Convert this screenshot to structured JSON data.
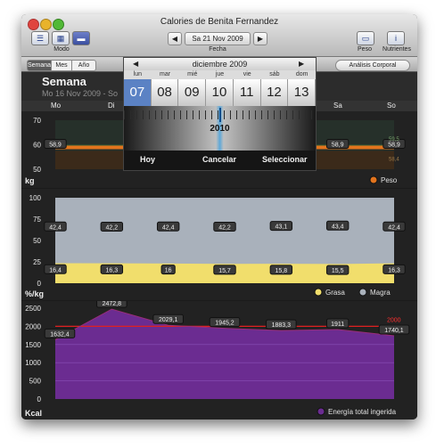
{
  "window": {
    "title": "Calories de Benita Fernandez"
  },
  "toolbar": {
    "date_prev": "◀",
    "date_value": "Sa 21 Nov 2009",
    "date_next": "▶",
    "modo_label": "Modo",
    "fecha_label": "Fecha",
    "peso_label": "Peso",
    "nutrientes_label": "Nutrientes"
  },
  "subbar": {
    "tabs": [
      "Semana",
      "Mes",
      "Año"
    ],
    "analysis_button": "Análisis Corporal"
  },
  "header": {
    "title": "Semana",
    "subtitle": "Mo 16 Nov 2009 - So"
  },
  "days": {
    "mo": "Mo",
    "di": "Di",
    "sa": "Sa",
    "so": "So"
  },
  "calendar": {
    "month": "diciembre 2009",
    "prev": "◀",
    "next": "▶",
    "weekdays": [
      "lun",
      "mar",
      "mié",
      "jue",
      "vie",
      "sáb",
      "dom"
    ],
    "dates": [
      "07",
      "08",
      "09",
      "10",
      "11",
      "12",
      "13"
    ],
    "selected_index": 0,
    "year": "2010",
    "hoy": "Hoy",
    "cancelar": "Cancelar",
    "seleccionar": "Seleccionar"
  },
  "colors": {
    "weight_line": "#e2741d",
    "fat_area": "#f1de6c",
    "lean_area": "#a9b1bb",
    "energy_area": "#6b2c91",
    "target_line": "#e02020",
    "selected_date": "#5b82c4"
  },
  "chart_data": [
    {
      "type": "line",
      "ylabel": "kg",
      "ylim": [
        50,
        70
      ],
      "yticks": [
        "70",
        "60",
        "50"
      ],
      "values": [
        58.9,
        58.9,
        58.9,
        58.9,
        58.9,
        58.9,
        58.9
      ],
      "value_labels": [
        "58,9",
        "58,9",
        "58,9"
      ],
      "extra_labels": [
        "59,5",
        "58,4"
      ],
      "legend": [
        "Peso"
      ]
    },
    {
      "type": "area",
      "ylabel": "%/kg",
      "ylim": [
        0,
        100
      ],
      "yticks": [
        "100",
        "75",
        "50",
        "25",
        "0"
      ],
      "series": [
        {
          "name": "Grasa",
          "values": [
            16.4,
            16.3,
            16,
            15.7,
            15.8,
            15.5,
            16.3
          ],
          "labels": [
            "16,4",
            "16,3",
            "16",
            "15,7",
            "15,8",
            "15,5",
            "16,3"
          ]
        },
        {
          "name": "Magra",
          "values": [
            42.4,
            42.2,
            42.4,
            42.2,
            43.1,
            43.4,
            42.4
          ],
          "labels": [
            "42,4",
            "42,2",
            "42,4",
            "42,2",
            "43,1",
            "43,4",
            "42,4"
          ]
        }
      ]
    },
    {
      "type": "area",
      "ylabel": "Kcal",
      "ylim": [
        0,
        2500
      ],
      "yticks": [
        "2500",
        "2000",
        "1500",
        "1000",
        "500",
        "0"
      ],
      "series": [
        {
          "name": "Energía total ingerida",
          "values": [
            1632.4,
            2472.8,
            2029.1,
            1945.2,
            1883.3,
            1911,
            1740.1
          ],
          "labels": [
            "1632,4",
            "2472,8",
            "2029,1",
            "1945,2",
            "1883,3",
            "1911",
            "1740,1"
          ]
        }
      ],
      "target": 2000,
      "target_label": "2000"
    }
  ]
}
